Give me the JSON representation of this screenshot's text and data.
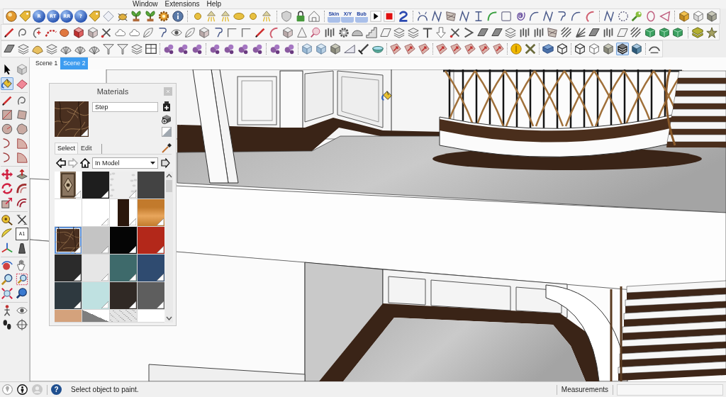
{
  "menu_bar": [
    "Window",
    "Extensions",
    "Help"
  ],
  "toolbars": [
    {
      "groups": [
        [
          {
            "kind": "orb",
            "selected": false
          },
          {
            "kind": "tag",
            "selected": false
          },
          {
            "kind": "badge",
            "label": "R",
            "selected": false
          },
          {
            "kind": "badge",
            "label": "RT",
            "selected": false
          },
          {
            "kind": "badge",
            "label": "RR",
            "selected": false
          },
          {
            "kind": "badge",
            "label": "?",
            "selected": false
          },
          {
            "kind": "tag",
            "selected": false
          },
          {
            "kind": "diamond",
            "selected": false
          },
          {
            "kind": "bug",
            "selected": false
          },
          {
            "kind": "plant",
            "selected": false
          },
          {
            "kind": "plant",
            "selected": false
          },
          {
            "kind": "gear",
            "selected": false
          },
          {
            "kind": "info",
            "selected": false
          }
        ],
        [
          {
            "kind": "dot",
            "selected": false
          },
          {
            "kind": "lamp",
            "selected": false
          },
          {
            "kind": "lamp",
            "selected": false
          },
          {
            "kind": "ellipse",
            "selected": false
          },
          {
            "kind": "dot",
            "selected": false
          },
          {
            "kind": "lamp",
            "selected": false
          }
        ],
        [
          {
            "kind": "shield",
            "selected": false
          },
          {
            "kind": "lock",
            "selected": false
          },
          {
            "kind": "tent",
            "selected": false
          }
        ],
        [
          {
            "kind": "word",
            "label": "Skin",
            "selected": false
          },
          {
            "kind": "word",
            "label": "X/Y",
            "selected": false
          },
          {
            "kind": "word",
            "label": "Bub",
            "selected": false
          },
          {
            "kind": "play",
            "selected": false
          },
          {
            "kind": "stop",
            "selected": false
          },
          {
            "kind": "swirl",
            "selected": false
          }
        ],
        [
          {
            "kind": "arch",
            "selected": false
          },
          {
            "kind": "zigzag",
            "selected": false
          },
          {
            "kind": "hatch",
            "selected": false
          },
          {
            "kind": "zigzag",
            "selected": false
          },
          {
            "kind": "bracket",
            "selected": false
          },
          {
            "kind": "curve",
            "selected": false
          },
          {
            "kind": "square",
            "selected": false
          },
          {
            "kind": "spiral",
            "selected": false
          },
          {
            "kind": "arc",
            "selected": false
          },
          {
            "kind": "zigzag",
            "selected": false
          },
          {
            "kind": "hook",
            "selected": false
          },
          {
            "kind": "arc",
            "selected": false
          },
          {
            "kind": "crescent",
            "selected": false
          }
        ],
        [
          {
            "kind": "zigzag",
            "selected": false
          },
          {
            "kind": "ring",
            "selected": false
          },
          {
            "kind": "wrench",
            "selected": false
          },
          {
            "kind": "oval",
            "selected": false
          },
          {
            "kind": "triangle",
            "selected": false
          }
        ],
        [
          {
            "kind": "goldcube",
            "selected": false
          },
          {
            "kind": "cube",
            "selected": false
          },
          {
            "kind": "greycube",
            "selected": false
          }
        ]
      ]
    },
    {
      "groups": [
        [
          {
            "kind": "pencil",
            "selected": false
          },
          {
            "kind": "loop",
            "selected": false
          },
          {
            "kind": "arcplus",
            "selected": false
          },
          {
            "kind": "dots",
            "selected": false
          },
          {
            "kind": "blob",
            "selected": false
          },
          {
            "kind": "redbox",
            "selected": false
          },
          {
            "kind": "box",
            "selected": false
          },
          {
            "kind": "scissors",
            "selected": false
          },
          {
            "kind": "cloud",
            "selected": false
          },
          {
            "kind": "cloud",
            "selected": false
          },
          {
            "kind": "leaf",
            "selected": false
          },
          {
            "kind": "hook",
            "selected": false
          },
          {
            "kind": "eye",
            "selected": false
          },
          {
            "kind": "leaf",
            "selected": false
          },
          {
            "kind": "box",
            "selected": false
          },
          {
            "kind": "hook",
            "selected": false
          },
          {
            "kind": "angle",
            "selected": false
          },
          {
            "kind": "angle",
            "selected": false
          },
          {
            "kind": "pencil",
            "selected": false
          },
          {
            "kind": "crescent",
            "selected": false
          },
          {
            "kind": "box",
            "selected": false
          },
          {
            "kind": "cone",
            "selected": false
          },
          {
            "kind": "pin",
            "selected": false
          },
          {
            "kind": "bars",
            "selected": false
          },
          {
            "kind": "cog",
            "selected": false
          },
          {
            "kind": "dome",
            "selected": false
          },
          {
            "kind": "stairs",
            "selected": false
          },
          {
            "kind": "panel",
            "selected": false
          },
          {
            "kind": "stack",
            "selected": false
          },
          {
            "kind": "stack",
            "selected": false
          },
          {
            "kind": "nail",
            "selected": false
          },
          {
            "kind": "arrowdown",
            "selected": false
          },
          {
            "kind": "scissors",
            "selected": false
          },
          {
            "kind": "chevron",
            "selected": false
          },
          {
            "kind": "slab",
            "selected": false
          },
          {
            "kind": "slab",
            "selected": false
          },
          {
            "kind": "stack",
            "selected": false
          },
          {
            "kind": "bars",
            "selected": false
          },
          {
            "kind": "bars",
            "selected": false
          },
          {
            "kind": "hatch",
            "selected": false
          },
          {
            "kind": "lines",
            "selected": false
          },
          {
            "kind": "fan",
            "selected": false
          },
          {
            "kind": "slab",
            "selected": false
          },
          {
            "kind": "bars",
            "selected": false
          },
          {
            "kind": "panel",
            "selected": false
          },
          {
            "kind": "lines",
            "selected": false
          },
          {
            "kind": "greenbox",
            "selected": false
          },
          {
            "kind": "greenbox",
            "selected": false
          },
          {
            "kind": "greenbox",
            "selected": false
          }
        ],
        [
          {
            "kind": "goldstack",
            "selected": false
          },
          {
            "kind": "star",
            "selected": false
          }
        ]
      ]
    },
    {
      "groups": [
        [
          {
            "kind": "slab",
            "selected": false
          },
          {
            "kind": "stack",
            "selected": false
          },
          {
            "kind": "hat",
            "selected": false
          },
          {
            "kind": "stack",
            "selected": false
          },
          {
            "kind": "mesh",
            "selected": false
          },
          {
            "kind": "mesh",
            "selected": false
          },
          {
            "kind": "mesh",
            "selected": false
          },
          {
            "kind": "funnel",
            "selected": false
          },
          {
            "kind": "funnel",
            "selected": false
          },
          {
            "kind": "stack",
            "selected": false
          },
          {
            "kind": "frame",
            "selected": false
          }
        ],
        [
          {
            "kind": "berry",
            "selected": false
          },
          {
            "kind": "berry",
            "selected": false
          },
          {
            "kind": "berry",
            "selected": false
          }
        ],
        [
          {
            "kind": "berry",
            "selected": false
          },
          {
            "kind": "berry",
            "selected": false
          },
          {
            "kind": "berry",
            "selected": false
          },
          {
            "kind": "berry",
            "selected": false
          }
        ],
        [
          {
            "kind": "berry",
            "selected": false
          },
          {
            "kind": "berry",
            "selected": false
          }
        ],
        [
          {
            "kind": "glass",
            "selected": false
          },
          {
            "kind": "glass",
            "selected": false
          },
          {
            "kind": "greycube",
            "selected": false
          },
          {
            "kind": "wedge",
            "selected": false
          },
          {
            "kind": "sword",
            "selected": false
          },
          {
            "kind": "bowl",
            "selected": false
          }
        ],
        [
          {
            "kind": "tile",
            "selected": false
          },
          {
            "kind": "tile",
            "selected": false
          },
          {
            "kind": "tile",
            "selected": false
          }
        ],
        [
          {
            "kind": "tile",
            "selected": false
          },
          {
            "kind": "tile",
            "selected": false
          },
          {
            "kind": "tile",
            "selected": false
          },
          {
            "kind": "tile",
            "selected": false
          },
          {
            "kind": "tile",
            "selected": false
          }
        ],
        [
          {
            "kind": "coin",
            "selected": false
          },
          {
            "kind": "tools",
            "selected": false
          }
        ],
        [
          {
            "kind": "book",
            "selected": false
          },
          {
            "kind": "wirebox",
            "selected": false
          }
        ],
        [
          {
            "kind": "wirebox",
            "selected": false
          },
          {
            "kind": "whitebox",
            "selected": false
          },
          {
            "kind": "greycube",
            "selected": false
          },
          {
            "kind": "mono",
            "selected": true
          },
          {
            "kind": "bluebox",
            "selected": false
          }
        ],
        [
          {
            "kind": "cap",
            "selected": false
          }
        ]
      ]
    }
  ],
  "tool_palette": {
    "groups": [
      [
        {
          "kind": "arrow",
          "selected": false
        },
        {
          "kind": "component",
          "selected": false
        },
        {
          "kind": "bucket",
          "selected": true
        },
        {
          "kind": "eraser",
          "selected": false
        }
      ],
      [
        {
          "kind": "pencil",
          "selected": false
        },
        {
          "kind": "loop",
          "selected": false
        },
        {
          "kind": "rect",
          "selected": false
        },
        {
          "kind": "rotrect",
          "selected": false
        },
        {
          "kind": "circle",
          "selected": false
        },
        {
          "kind": "polygon",
          "selected": false
        },
        {
          "kind": "larc",
          "selected": false
        },
        {
          "kind": "pie",
          "selected": false
        },
        {
          "kind": "larc",
          "selected": false
        },
        {
          "kind": "pie",
          "selected": false
        }
      ],
      [
        {
          "kind": "move",
          "selected": false
        },
        {
          "kind": "pushpull",
          "selected": false
        },
        {
          "kind": "rotate",
          "selected": false
        },
        {
          "kind": "followme",
          "selected": false
        },
        {
          "kind": "scale",
          "selected": false
        },
        {
          "kind": "offset",
          "selected": false
        }
      ],
      [
        {
          "kind": "tape",
          "selected": false
        },
        {
          "kind": "dimension",
          "selected": false
        },
        {
          "kind": "protractor",
          "selected": false
        },
        {
          "kind": "textbox",
          "label": "A1",
          "selected": false
        },
        {
          "kind": "axes",
          "selected": false
        },
        {
          "kind": "text3d",
          "selected": false
        }
      ],
      [
        {
          "kind": "orbit",
          "selected": false
        },
        {
          "kind": "pan",
          "selected": false
        },
        {
          "kind": "zoom",
          "selected": false
        },
        {
          "kind": "zoomwin",
          "selected": false
        },
        {
          "kind": "zoomext",
          "selected": false
        },
        {
          "kind": "zoomprev",
          "selected": false
        }
      ],
      [
        {
          "kind": "camera",
          "selected": false
        },
        {
          "kind": "eye",
          "selected": false
        },
        {
          "kind": "feet",
          "selected": false
        },
        {
          "kind": "target",
          "selected": false
        }
      ]
    ]
  },
  "scene_tabs": [
    {
      "label": "Scene 1",
      "selected": false
    },
    {
      "label": "Scene 2",
      "selected": true
    }
  ],
  "materials": {
    "title": "Materials",
    "current": {
      "name": "Step",
      "kind": "marble",
      "color": "#4a3020",
      "in_use": true
    },
    "tabs": [
      {
        "label": "Select",
        "selected": true
      },
      {
        "label": "Edit",
        "selected": false
      }
    ],
    "nav": [
      {
        "kind": "back",
        "disabled": false
      },
      {
        "kind": "forward",
        "disabled": true
      }
    ],
    "library": "In Model",
    "swatches": [
      {
        "kind": "pattern",
        "color": "#8a7560",
        "in_use": true,
        "selected": false
      },
      {
        "kind": "solid",
        "color": "#1e1e1e",
        "in_use": true,
        "selected": false
      },
      {
        "kind": "speckle",
        "color": "#eeeeee",
        "in_use": true,
        "selected": false
      },
      {
        "kind": "solid",
        "color": "#434343",
        "in_use": false,
        "selected": false
      },
      {
        "kind": "solid",
        "color": "#ffffff",
        "in_use": false,
        "selected": false
      },
      {
        "kind": "solid",
        "color": "#ffffff",
        "in_use": true,
        "selected": false
      },
      {
        "kind": "strip",
        "color": "#2a170c",
        "in_use": true,
        "selected": false
      },
      {
        "kind": "gradient",
        "color": "#c27a2c",
        "in_use": true,
        "selected": false
      },
      {
        "kind": "marble",
        "color": "#4a3020",
        "in_use": true,
        "selected": true
      },
      {
        "kind": "solid",
        "color": "#c4c4c4",
        "in_use": true,
        "selected": false
      },
      {
        "kind": "solid",
        "color": "#050505",
        "in_use": true,
        "selected": false
      },
      {
        "kind": "solid",
        "color": "#b3281a",
        "in_use": true,
        "selected": false
      },
      {
        "kind": "solid",
        "color": "#2b2b2b",
        "in_use": true,
        "selected": false
      },
      {
        "kind": "solid",
        "color": "#e6e6e6",
        "in_use": true,
        "selected": false
      },
      {
        "kind": "solid",
        "color": "#3e6a6b",
        "in_use": true,
        "selected": false
      },
      {
        "kind": "solid",
        "color": "#2f4b70",
        "in_use": true,
        "selected": false
      },
      {
        "kind": "solid",
        "color": "#2e393f",
        "in_use": true,
        "selected": false
      },
      {
        "kind": "solid",
        "color": "#bfe1e1",
        "in_use": true,
        "selected": false
      },
      {
        "kind": "solid",
        "color": "#302925",
        "in_use": true,
        "selected": false
      },
      {
        "kind": "solid",
        "color": "#5e5e5e",
        "in_use": true,
        "selected": false
      },
      {
        "kind": "solid",
        "color": "#d4a27c",
        "in_use": false,
        "selected": false
      },
      {
        "kind": "diagonal",
        "color": "#7e7e7e",
        "in_use": false,
        "selected": false
      },
      {
        "kind": "noise",
        "color": "#e4e4e4",
        "in_use": false,
        "selected": false
      },
      {
        "kind": "solid",
        "color": "#ffffff",
        "in_use": false,
        "selected": false
      }
    ]
  },
  "status_bar": {
    "help": "?",
    "message": "Select object to paint.",
    "measurements_label": "Measurements"
  }
}
